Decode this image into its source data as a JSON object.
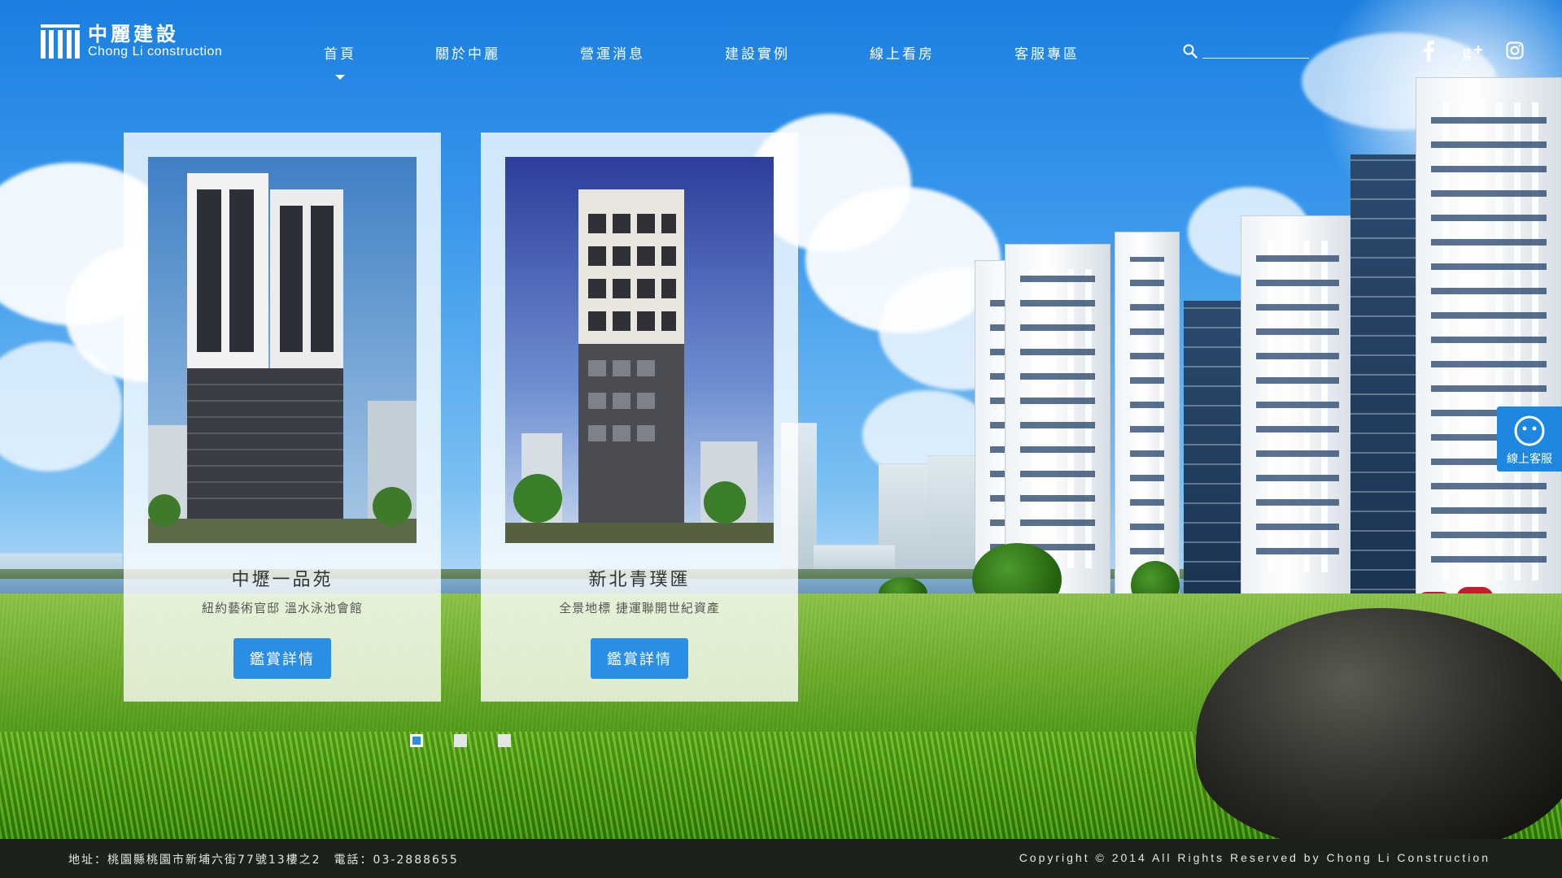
{
  "brand": {
    "name_cn": "中麗建設",
    "name_en": "Chong Li construction"
  },
  "nav": {
    "items": [
      {
        "label": "首頁",
        "active": true
      },
      {
        "label": "關於中麗"
      },
      {
        "label": "營運消息"
      },
      {
        "label": "建設實例"
      },
      {
        "label": "線上看房"
      },
      {
        "label": "客服專區"
      }
    ]
  },
  "search": {
    "icon": "search-icon",
    "value": "",
    "placeholder": ""
  },
  "social": [
    {
      "name": "facebook-icon"
    },
    {
      "name": "google-plus-icon"
    },
    {
      "name": "instagram-icon"
    }
  ],
  "projects": [
    {
      "title": "中壢一品苑",
      "subtitle": "紐約藝術官邸 溫水泳池會館",
      "button": "鑑賞詳情"
    },
    {
      "title": "新北青璞匯",
      "subtitle": "全景地標 捷運聯開世紀資產",
      "button": "鑑賞詳情"
    }
  ],
  "carousel": {
    "page_count": 3,
    "active_page": 1
  },
  "service": {
    "label": "線上客服",
    "icon": "chat-icon"
  },
  "footer": {
    "address": "地址：桃園縣桃園市新埔六街77號13樓之2　電話：03-2888655",
    "copyright": "Copyright © 2014 All Rights Reserved by Chong Li Construction"
  },
  "colors": {
    "accent": "#2a8fe4",
    "footer_bg": "#1c211a"
  }
}
